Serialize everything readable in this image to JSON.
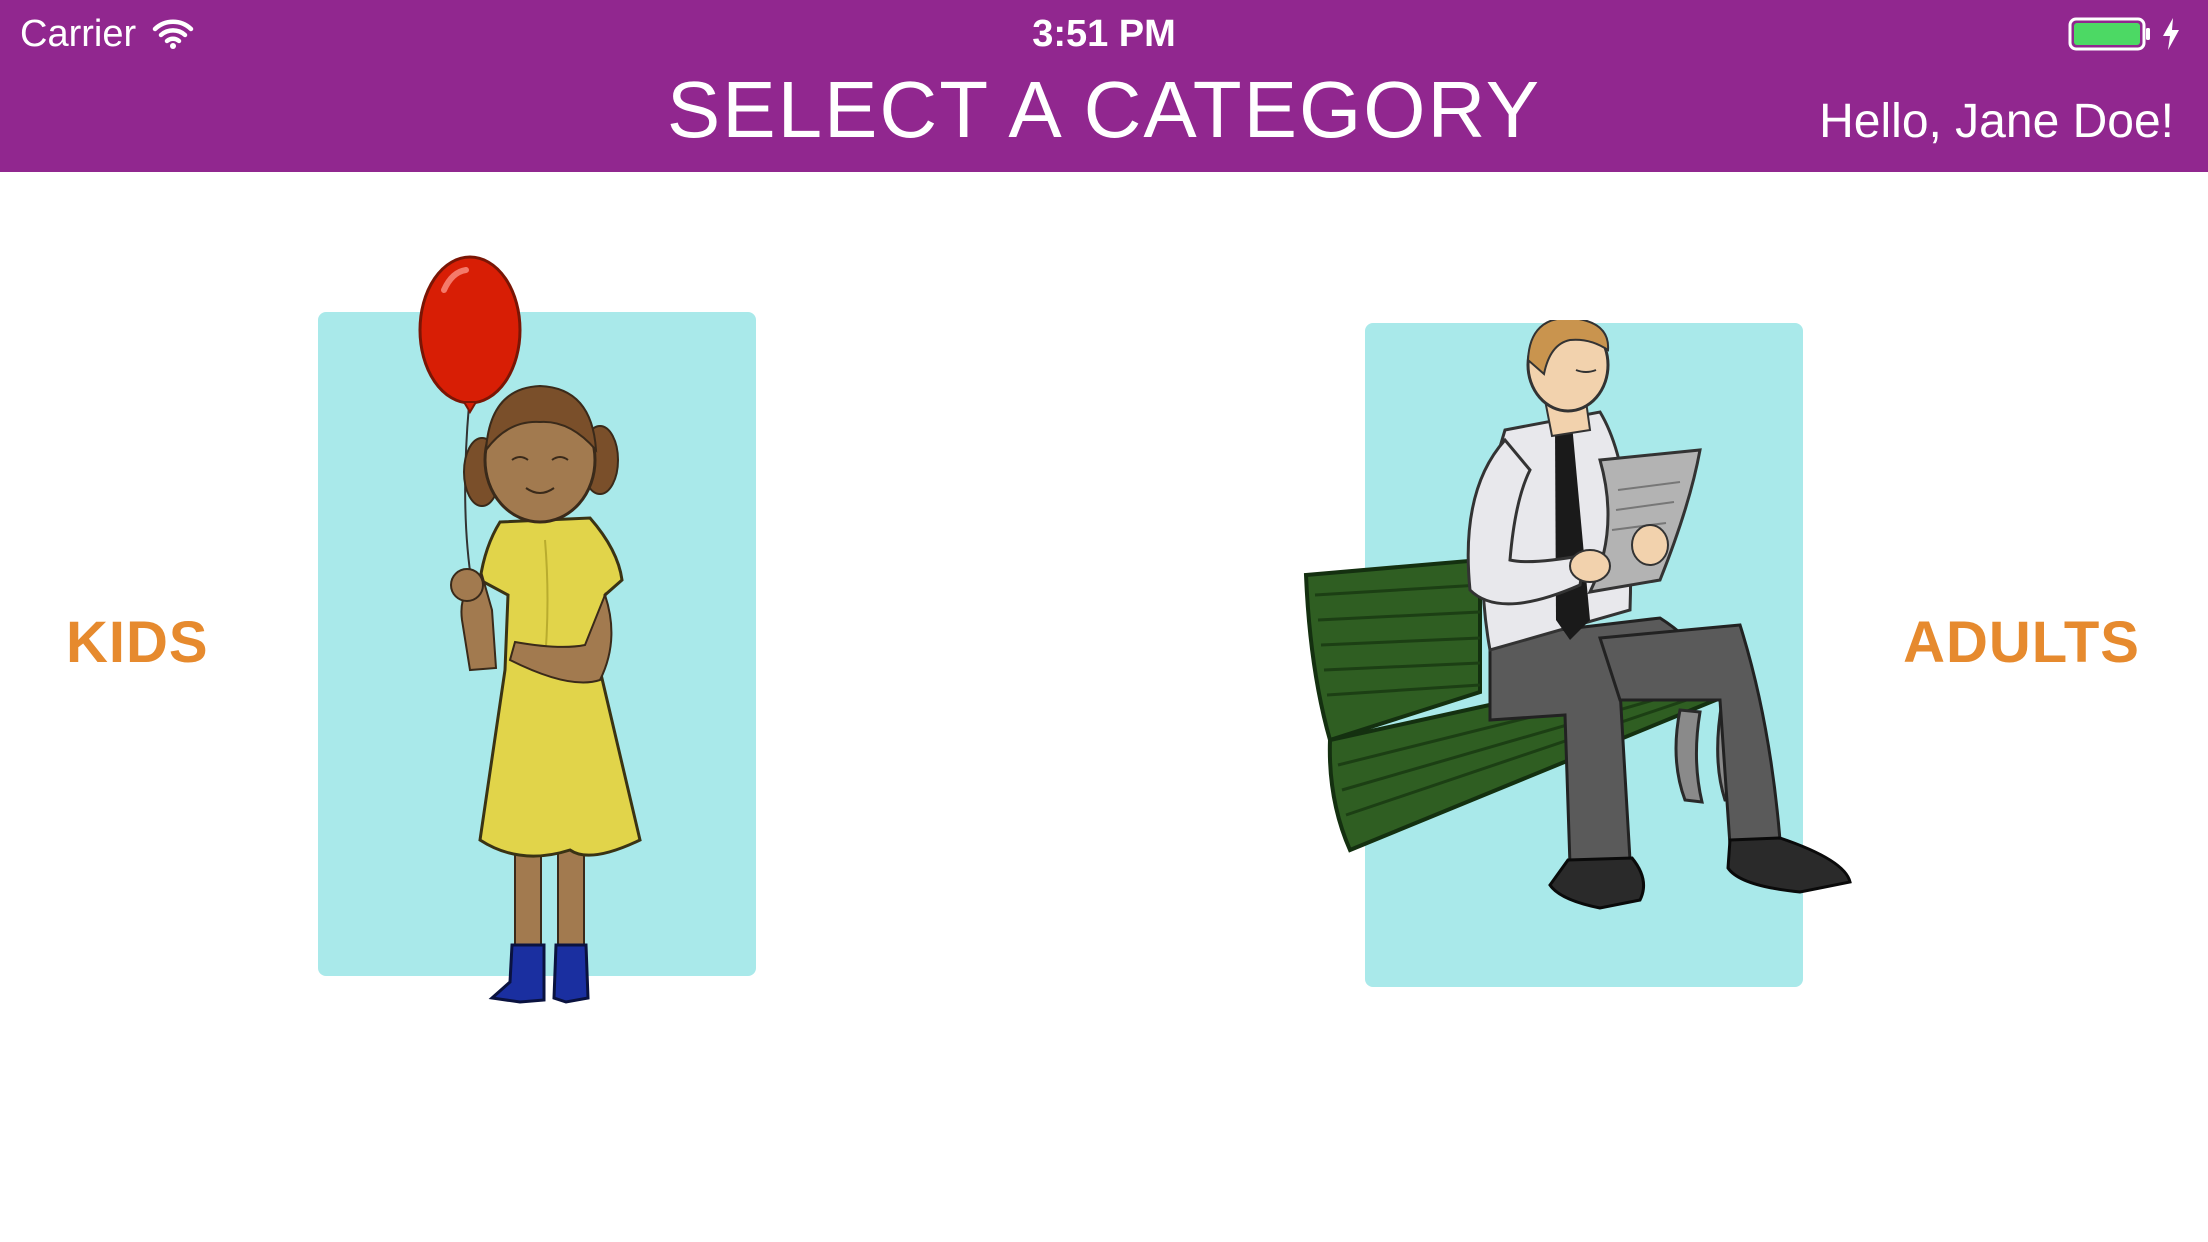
{
  "status_bar": {
    "carrier": "Carrier",
    "time": "3:51 PM",
    "icons": [
      "wifi-icon",
      "battery-icon",
      "charging-bolt-icon"
    ]
  },
  "header": {
    "title": "SELECT A CATEGORY",
    "greeting": "Hello, Jane Doe!"
  },
  "categories": [
    {
      "label": "KIDS",
      "illustration": "girl-with-red-balloon"
    },
    {
      "label": "ADULTS",
      "illustration": "man-reading-newspaper-on-bench"
    }
  ],
  "colors": {
    "header_bg": "#91278f",
    "accent": "#e68a2e",
    "card_bg": "#a9e9ea",
    "battery": "#4cd964"
  }
}
